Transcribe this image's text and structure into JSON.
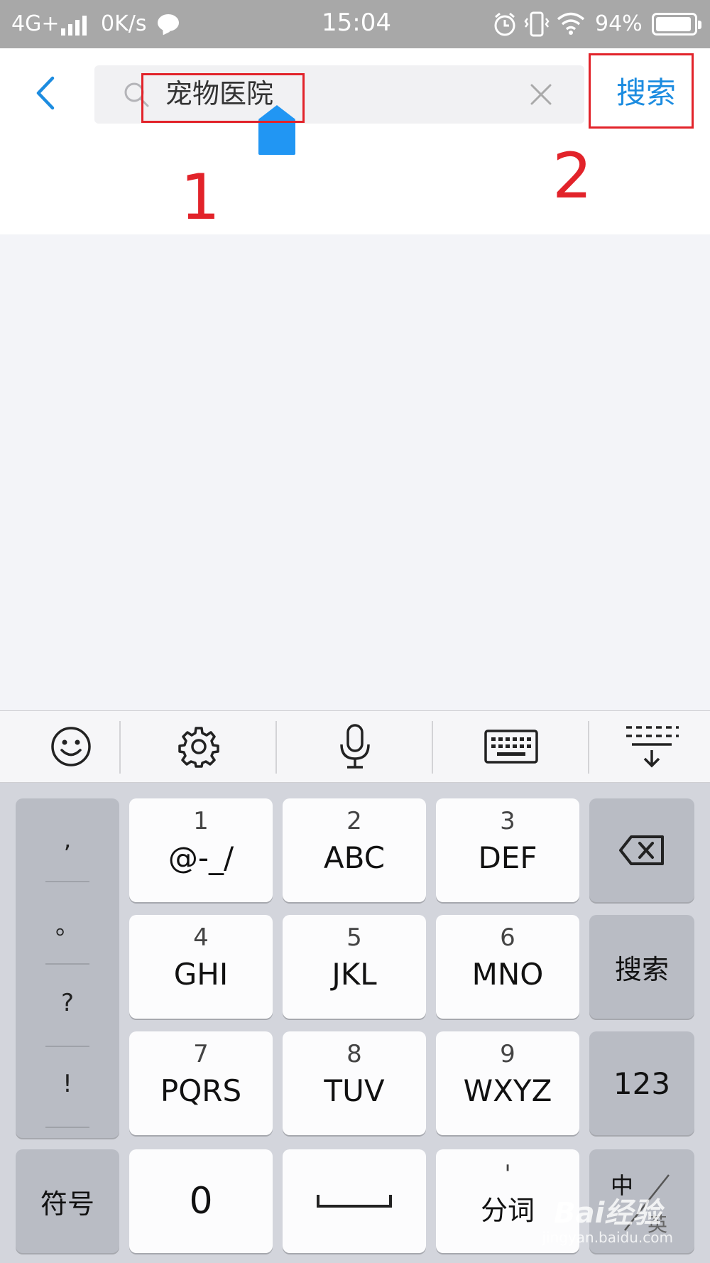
{
  "status_bar": {
    "network": "4G+",
    "speed": "0K/s",
    "time": "15:04",
    "battery": "94%",
    "battery_level": 0.94
  },
  "header": {
    "search_query": "宠物医院",
    "search_button": "搜索",
    "annotation_1": "1",
    "annotation_2": "2"
  },
  "toolbar": {
    "items": [
      "emoji-icon",
      "settings-icon",
      "microphone-icon",
      "keyboard-icon",
      "collapse-keyboard-icon"
    ]
  },
  "keyboard": {
    "punctuation": [
      ",",
      "。",
      "?",
      "!"
    ],
    "keys": [
      {
        "num": "1",
        "letters": "@-_/"
      },
      {
        "num": "2",
        "letters": "ABC"
      },
      {
        "num": "3",
        "letters": "DEF"
      },
      {
        "num": "4",
        "letters": "GHI"
      },
      {
        "num": "5",
        "letters": "JKL"
      },
      {
        "num": "6",
        "letters": "MNO"
      },
      {
        "num": "7",
        "letters": "PQRS"
      },
      {
        "num": "8",
        "letters": "TUV"
      },
      {
        "num": "9",
        "letters": "WXYZ"
      }
    ],
    "search_key": "搜索",
    "numbers_key": "123",
    "symbols_key": "符号",
    "zero_key": "0",
    "segment_key": "分词",
    "segment_mark": "'",
    "lang_key": "中",
    "lang_key_alt": "英"
  },
  "watermark": {
    "brand": "Bai经验",
    "url": "jingyan.baidu.com"
  },
  "colors": {
    "accent": "#1c8ce0",
    "annotation": "#e2232a",
    "cursor": "#2196f3"
  }
}
